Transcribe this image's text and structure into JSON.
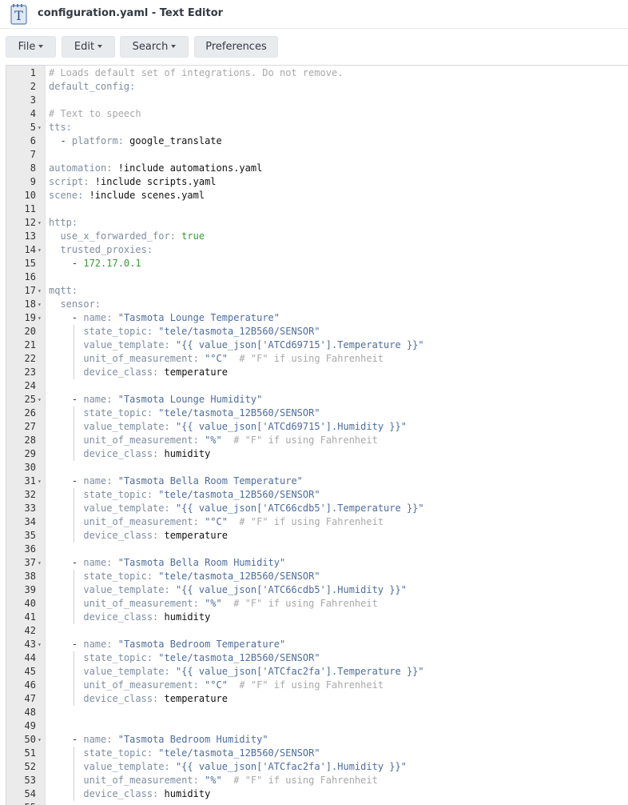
{
  "window": {
    "title": "configuration.yaml - Text Editor"
  },
  "toolbar": {
    "file_label": "File",
    "edit_label": "Edit",
    "search_label": "Search",
    "preferences_label": "Preferences"
  },
  "editor": {
    "lines": [
      {
        "n": "1",
        "fold": false,
        "guides": 0,
        "tokens": [
          {
            "t": "comment",
            "v": "# Loads default set of integrations. Do not remove."
          }
        ]
      },
      {
        "n": "2",
        "fold": false,
        "guides": 0,
        "tokens": [
          {
            "t": "key",
            "v": "default_config:"
          }
        ]
      },
      {
        "n": "3",
        "fold": false,
        "guides": 0,
        "tokens": []
      },
      {
        "n": "4",
        "fold": false,
        "guides": 0,
        "tokens": [
          {
            "t": "comment",
            "v": "# Text to speech"
          }
        ]
      },
      {
        "n": "5",
        "fold": true,
        "guides": 0,
        "tokens": [
          {
            "t": "key",
            "v": "tts:"
          }
        ]
      },
      {
        "n": "6",
        "fold": false,
        "guides": 0,
        "tokens": [
          {
            "t": "dash",
            "v": "  - "
          },
          {
            "t": "key",
            "v": "platform: "
          },
          {
            "t": "plain",
            "v": "google_translate"
          }
        ]
      },
      {
        "n": "7",
        "fold": false,
        "guides": 0,
        "tokens": []
      },
      {
        "n": "8",
        "fold": false,
        "guides": 0,
        "tokens": [
          {
            "t": "key",
            "v": "automation: "
          },
          {
            "t": "plain",
            "v": "!include automations.yaml"
          }
        ]
      },
      {
        "n": "9",
        "fold": false,
        "guides": 0,
        "tokens": [
          {
            "t": "key",
            "v": "script: "
          },
          {
            "t": "plain",
            "v": "!include scripts.yaml"
          }
        ]
      },
      {
        "n": "10",
        "fold": false,
        "guides": 0,
        "tokens": [
          {
            "t": "key",
            "v": "scene: "
          },
          {
            "t": "plain",
            "v": "!include scenes.yaml"
          }
        ]
      },
      {
        "n": "11",
        "fold": false,
        "guides": 0,
        "tokens": []
      },
      {
        "n": "12",
        "fold": true,
        "guides": 0,
        "tokens": [
          {
            "t": "key",
            "v": "http:"
          }
        ]
      },
      {
        "n": "13",
        "fold": false,
        "guides": 0,
        "tokens": [
          {
            "t": "plain",
            "v": "  "
          },
          {
            "t": "key",
            "v": "use_x_forwarded_for: "
          },
          {
            "t": "green",
            "v": "true"
          }
        ]
      },
      {
        "n": "14",
        "fold": true,
        "guides": 0,
        "tokens": [
          {
            "t": "plain",
            "v": "  "
          },
          {
            "t": "key",
            "v": "trusted_proxies:"
          }
        ]
      },
      {
        "n": "15",
        "fold": false,
        "guides": 0,
        "tokens": [
          {
            "t": "dash",
            "v": "    - "
          },
          {
            "t": "green",
            "v": "172.17.0.1"
          }
        ]
      },
      {
        "n": "16",
        "fold": false,
        "guides": 0,
        "tokens": []
      },
      {
        "n": "17",
        "fold": true,
        "guides": 0,
        "tokens": [
          {
            "t": "key",
            "v": "mqtt:"
          }
        ]
      },
      {
        "n": "18",
        "fold": true,
        "guides": 0,
        "tokens": [
          {
            "t": "plain",
            "v": "  "
          },
          {
            "t": "key",
            "v": "sensor:"
          }
        ]
      },
      {
        "n": "19",
        "fold": true,
        "guides": 0,
        "tokens": [
          {
            "t": "dash",
            "v": "    - "
          },
          {
            "t": "key",
            "v": "name: "
          },
          {
            "t": "str",
            "v": "\"Tasmota Lounge Temperature\""
          }
        ]
      },
      {
        "n": "20",
        "fold": false,
        "guides": 1,
        "tokens": [
          {
            "t": "plain",
            "v": "      "
          },
          {
            "t": "key",
            "v": "state_topic: "
          },
          {
            "t": "str",
            "v": "\"tele/tasmota_12B560/SENSOR\""
          }
        ]
      },
      {
        "n": "21",
        "fold": false,
        "guides": 1,
        "tokens": [
          {
            "t": "plain",
            "v": "      "
          },
          {
            "t": "key",
            "v": "value_template: "
          },
          {
            "t": "str",
            "v": "\"{{ value_json['ATCd69715'].Temperature }}\""
          }
        ]
      },
      {
        "n": "22",
        "fold": false,
        "guides": 1,
        "tokens": [
          {
            "t": "plain",
            "v": "      "
          },
          {
            "t": "key",
            "v": "unit_of_measurement: "
          },
          {
            "t": "str",
            "v": "\"°C\""
          },
          {
            "t": "comment",
            "v": "  # \"F\" if using Fahrenheit"
          }
        ]
      },
      {
        "n": "23",
        "fold": false,
        "guides": 1,
        "tokens": [
          {
            "t": "plain",
            "v": "      "
          },
          {
            "t": "key",
            "v": "device_class: "
          },
          {
            "t": "plain",
            "v": "temperature"
          }
        ]
      },
      {
        "n": "24",
        "fold": false,
        "guides": 0,
        "tokens": []
      },
      {
        "n": "25",
        "fold": true,
        "guides": 0,
        "tokens": [
          {
            "t": "dash",
            "v": "    - "
          },
          {
            "t": "key",
            "v": "name: "
          },
          {
            "t": "str",
            "v": "\"Tasmota Lounge Humidity\""
          }
        ]
      },
      {
        "n": "26",
        "fold": false,
        "guides": 1,
        "tokens": [
          {
            "t": "plain",
            "v": "      "
          },
          {
            "t": "key",
            "v": "state_topic: "
          },
          {
            "t": "str",
            "v": "\"tele/tasmota_12B560/SENSOR\""
          }
        ]
      },
      {
        "n": "27",
        "fold": false,
        "guides": 1,
        "tokens": [
          {
            "t": "plain",
            "v": "      "
          },
          {
            "t": "key",
            "v": "value_template: "
          },
          {
            "t": "str",
            "v": "\"{{ value_json['ATCd69715'].Humidity }}\""
          }
        ]
      },
      {
        "n": "28",
        "fold": false,
        "guides": 1,
        "tokens": [
          {
            "t": "plain",
            "v": "      "
          },
          {
            "t": "key",
            "v": "unit_of_measurement: "
          },
          {
            "t": "str",
            "v": "\"%\""
          },
          {
            "t": "comment",
            "v": "  # \"F\" if using Fahrenheit"
          }
        ]
      },
      {
        "n": "29",
        "fold": false,
        "guides": 1,
        "tokens": [
          {
            "t": "plain",
            "v": "      "
          },
          {
            "t": "key",
            "v": "device_class: "
          },
          {
            "t": "plain",
            "v": "humidity"
          }
        ]
      },
      {
        "n": "30",
        "fold": false,
        "guides": 0,
        "tokens": []
      },
      {
        "n": "31",
        "fold": true,
        "guides": 0,
        "tokens": [
          {
            "t": "dash",
            "v": "    - "
          },
          {
            "t": "key",
            "v": "name: "
          },
          {
            "t": "str",
            "v": "\"Tasmota Bella Room Temperature\""
          }
        ]
      },
      {
        "n": "32",
        "fold": false,
        "guides": 1,
        "tokens": [
          {
            "t": "plain",
            "v": "      "
          },
          {
            "t": "key",
            "v": "state_topic: "
          },
          {
            "t": "str",
            "v": "\"tele/tasmota_12B560/SENSOR\""
          }
        ]
      },
      {
        "n": "33",
        "fold": false,
        "guides": 1,
        "tokens": [
          {
            "t": "plain",
            "v": "      "
          },
          {
            "t": "key",
            "v": "value_template: "
          },
          {
            "t": "str",
            "v": "\"{{ value_json['ATC66cdb5'].Temperature }}\""
          }
        ]
      },
      {
        "n": "34",
        "fold": false,
        "guides": 1,
        "tokens": [
          {
            "t": "plain",
            "v": "      "
          },
          {
            "t": "key",
            "v": "unit_of_measurement: "
          },
          {
            "t": "str",
            "v": "\"°C\""
          },
          {
            "t": "comment",
            "v": "  # \"F\" if using Fahrenheit"
          }
        ]
      },
      {
        "n": "35",
        "fold": false,
        "guides": 1,
        "tokens": [
          {
            "t": "plain",
            "v": "      "
          },
          {
            "t": "key",
            "v": "device_class: "
          },
          {
            "t": "plain",
            "v": "temperature"
          }
        ]
      },
      {
        "n": "36",
        "fold": false,
        "guides": 0,
        "tokens": []
      },
      {
        "n": "37",
        "fold": true,
        "guides": 0,
        "tokens": [
          {
            "t": "dash",
            "v": "    - "
          },
          {
            "t": "key",
            "v": "name: "
          },
          {
            "t": "str",
            "v": "\"Tasmota Bella Room Humidity\""
          }
        ]
      },
      {
        "n": "38",
        "fold": false,
        "guides": 1,
        "tokens": [
          {
            "t": "plain",
            "v": "      "
          },
          {
            "t": "key",
            "v": "state_topic: "
          },
          {
            "t": "str",
            "v": "\"tele/tasmota_12B560/SENSOR\""
          }
        ]
      },
      {
        "n": "39",
        "fold": false,
        "guides": 1,
        "tokens": [
          {
            "t": "plain",
            "v": "      "
          },
          {
            "t": "key",
            "v": "value_template: "
          },
          {
            "t": "str",
            "v": "\"{{ value_json['ATC66cdb5'].Humidity }}\""
          }
        ]
      },
      {
        "n": "40",
        "fold": false,
        "guides": 1,
        "tokens": [
          {
            "t": "plain",
            "v": "      "
          },
          {
            "t": "key",
            "v": "unit_of_measurement: "
          },
          {
            "t": "str",
            "v": "\"%\""
          },
          {
            "t": "comment",
            "v": "  # \"F\" if using Fahrenheit"
          }
        ]
      },
      {
        "n": "41",
        "fold": false,
        "guides": 1,
        "tokens": [
          {
            "t": "plain",
            "v": "      "
          },
          {
            "t": "key",
            "v": "device_class: "
          },
          {
            "t": "plain",
            "v": "humidity"
          }
        ]
      },
      {
        "n": "42",
        "fold": false,
        "guides": 0,
        "tokens": []
      },
      {
        "n": "43",
        "fold": true,
        "guides": 0,
        "tokens": [
          {
            "t": "dash",
            "v": "    - "
          },
          {
            "t": "key",
            "v": "name: "
          },
          {
            "t": "str",
            "v": "\"Tasmota Bedroom Temperature\""
          }
        ]
      },
      {
        "n": "44",
        "fold": false,
        "guides": 1,
        "tokens": [
          {
            "t": "plain",
            "v": "      "
          },
          {
            "t": "key",
            "v": "state_topic: "
          },
          {
            "t": "str",
            "v": "\"tele/tasmota_12B560/SENSOR\""
          }
        ]
      },
      {
        "n": "45",
        "fold": false,
        "guides": 1,
        "tokens": [
          {
            "t": "plain",
            "v": "      "
          },
          {
            "t": "key",
            "v": "value_template: "
          },
          {
            "t": "str",
            "v": "\"{{ value_json['ATCfac2fa'].Temperature }}\""
          }
        ]
      },
      {
        "n": "46",
        "fold": false,
        "guides": 1,
        "tokens": [
          {
            "t": "plain",
            "v": "      "
          },
          {
            "t": "key",
            "v": "unit_of_measurement: "
          },
          {
            "t": "str",
            "v": "\"°C\""
          },
          {
            "t": "comment",
            "v": "  # \"F\" if using Fahrenheit"
          }
        ]
      },
      {
        "n": "47",
        "fold": false,
        "guides": 1,
        "tokens": [
          {
            "t": "plain",
            "v": "      "
          },
          {
            "t": "key",
            "v": "device_class: "
          },
          {
            "t": "plain",
            "v": "temperature"
          }
        ]
      },
      {
        "n": "48",
        "fold": false,
        "guides": 0,
        "tokens": []
      },
      {
        "n": "49",
        "fold": false,
        "guides": 0,
        "tokens": []
      },
      {
        "n": "50",
        "fold": true,
        "guides": 0,
        "tokens": [
          {
            "t": "dash",
            "v": "    - "
          },
          {
            "t": "key",
            "v": "name: "
          },
          {
            "t": "str",
            "v": "\"Tasmota Bedroom Humidity\""
          }
        ]
      },
      {
        "n": "51",
        "fold": false,
        "guides": 1,
        "tokens": [
          {
            "t": "plain",
            "v": "      "
          },
          {
            "t": "key",
            "v": "state_topic: "
          },
          {
            "t": "str",
            "v": "\"tele/tasmota_12B560/SENSOR\""
          }
        ]
      },
      {
        "n": "52",
        "fold": false,
        "guides": 1,
        "tokens": [
          {
            "t": "plain",
            "v": "      "
          },
          {
            "t": "key",
            "v": "value_template: "
          },
          {
            "t": "str",
            "v": "\"{{ value_json['ATCfac2fa'].Humidity }}\""
          }
        ]
      },
      {
        "n": "53",
        "fold": false,
        "guides": 1,
        "tokens": [
          {
            "t": "plain",
            "v": "      "
          },
          {
            "t": "key",
            "v": "unit_of_measurement: "
          },
          {
            "t": "str",
            "v": "\"%\""
          },
          {
            "t": "comment",
            "v": "  # \"F\" if using Fahrenheit"
          }
        ]
      },
      {
        "n": "54",
        "fold": false,
        "guides": 1,
        "tokens": [
          {
            "t": "plain",
            "v": "      "
          },
          {
            "t": "key",
            "v": "device_class: "
          },
          {
            "t": "plain",
            "v": "humidity"
          }
        ]
      },
      {
        "n": "55",
        "fold": false,
        "guides": 0,
        "tokens": []
      }
    ]
  }
}
